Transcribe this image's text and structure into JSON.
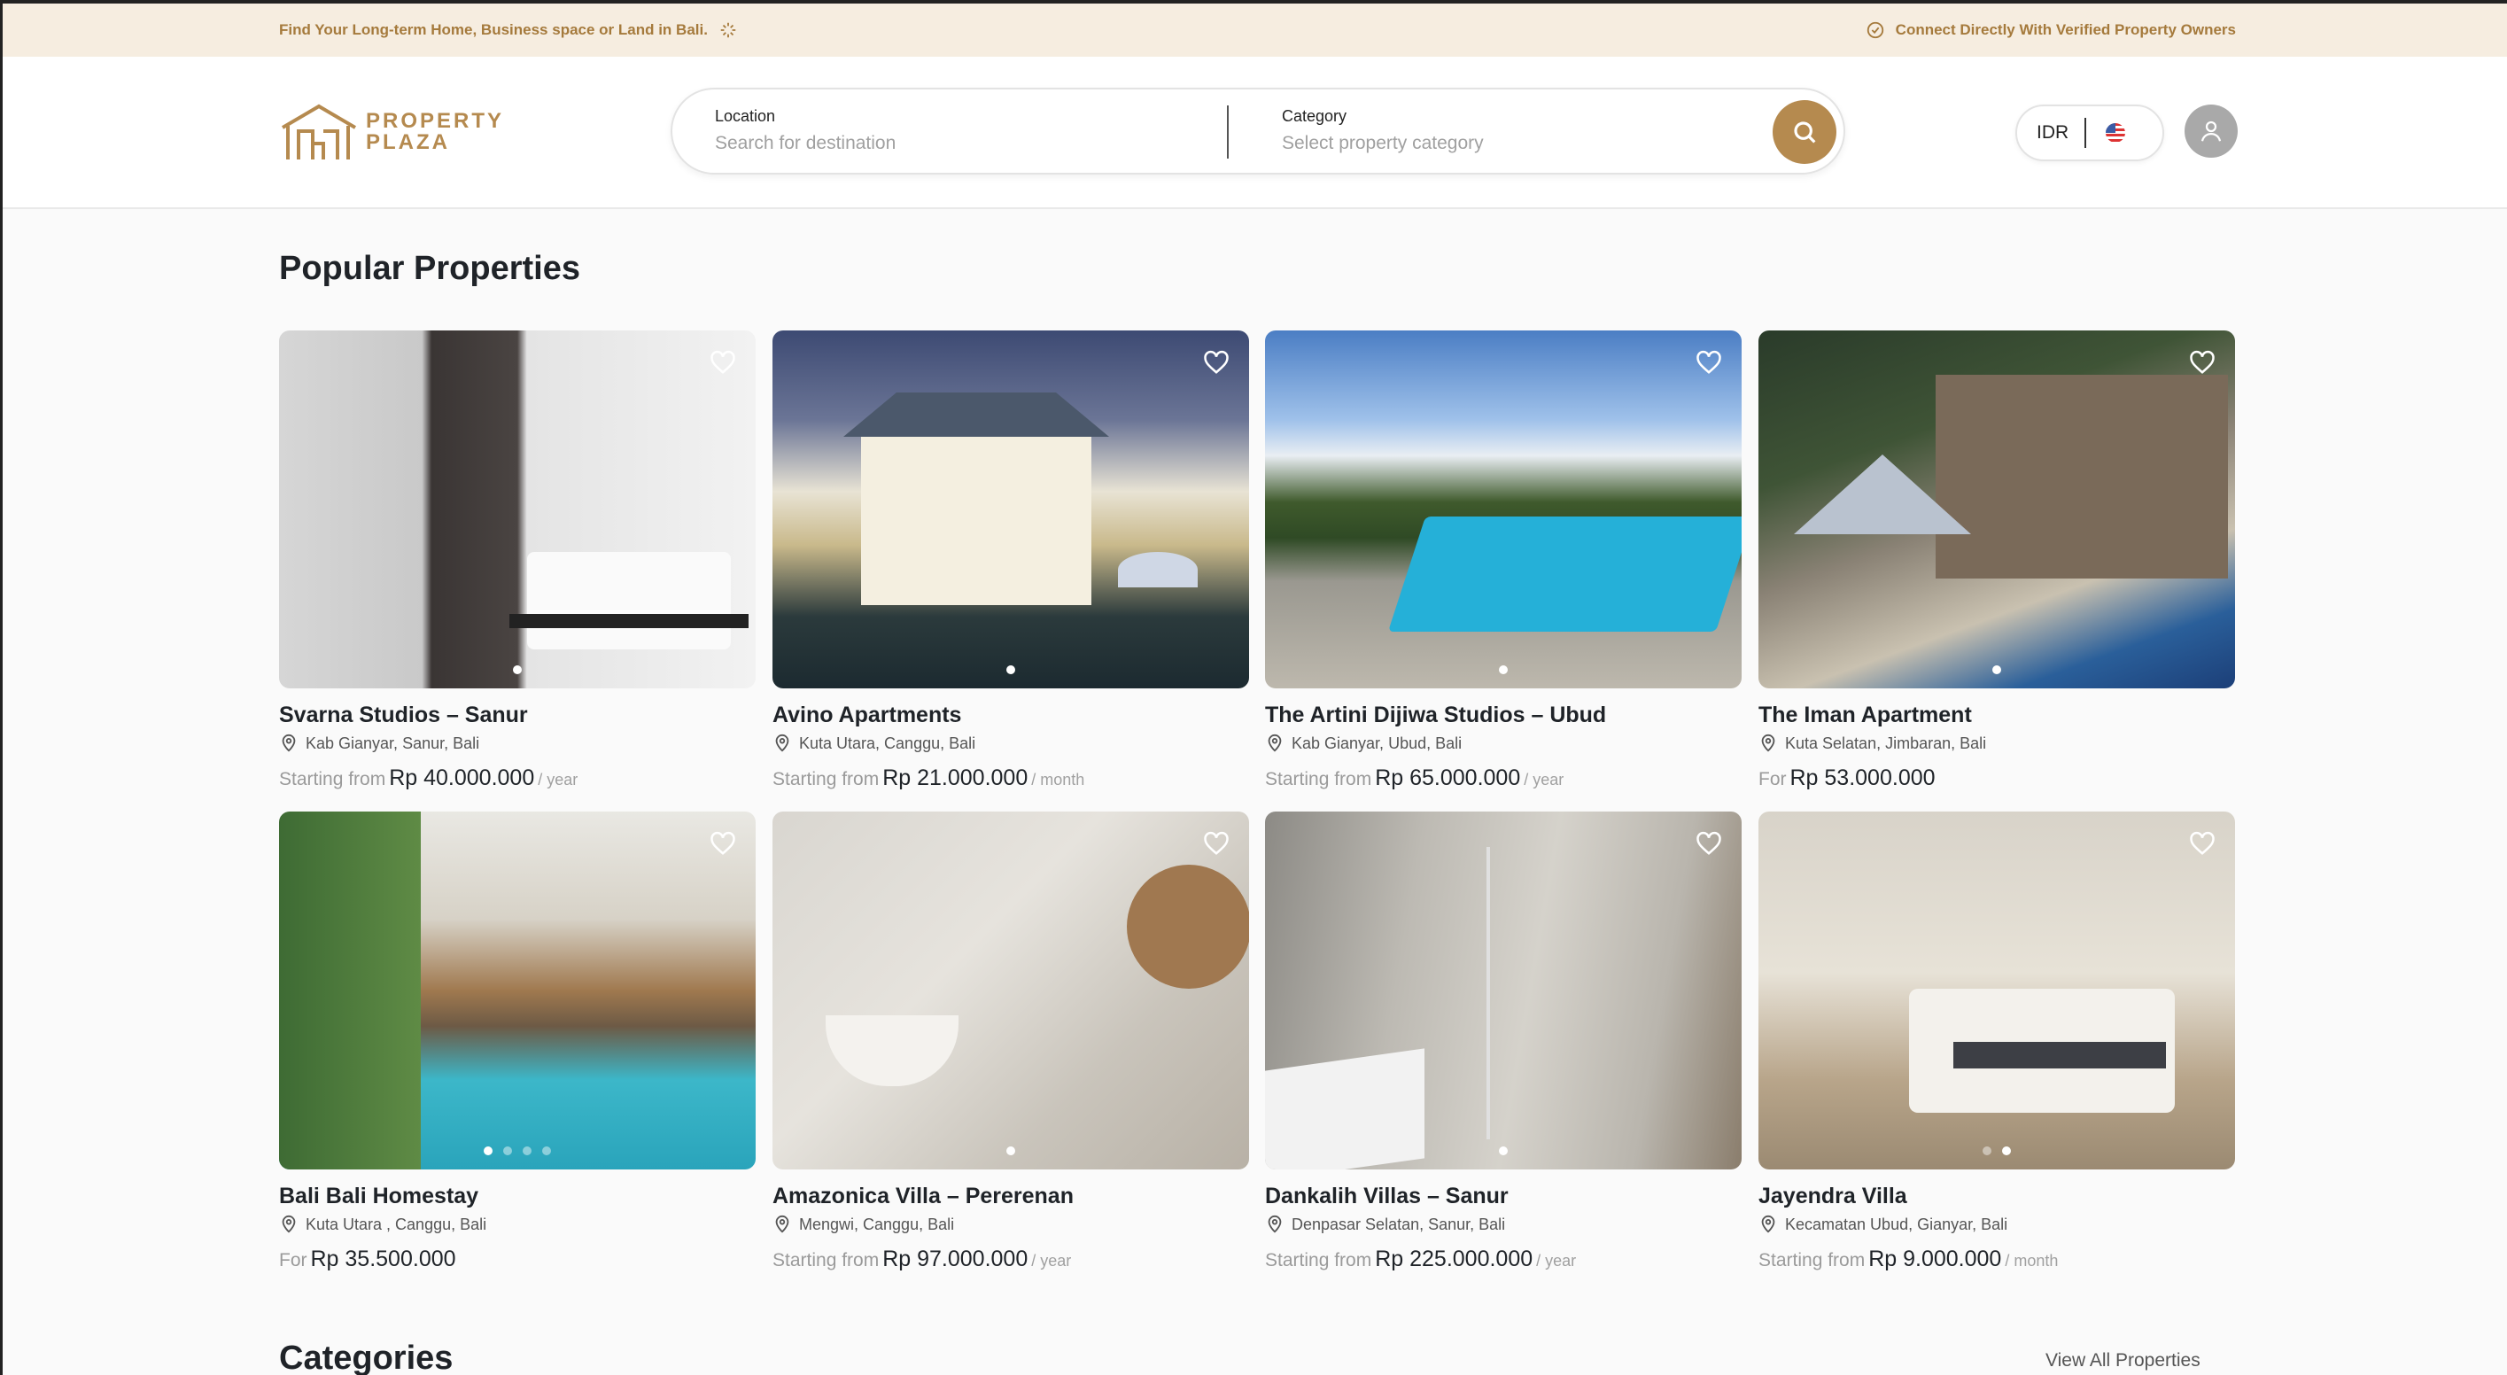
{
  "announcement": {
    "left_text": "Find Your Long-term Home, Business space or Land in Bali.",
    "right_text": "Connect Directly With Verified Property Owners"
  },
  "header": {
    "logo": {
      "line1": "PROPERTY",
      "line2": "PLAZA"
    },
    "search": {
      "location_label": "Location",
      "location_placeholder": "Search for destination",
      "category_label": "Category",
      "category_placeholder": "Select property category"
    },
    "currency": "IDR"
  },
  "colors": {
    "brand": "#b58a4f",
    "announcement_bg": "#f6ede0"
  },
  "popular": {
    "title": "Popular Properties",
    "items": [
      {
        "title": "Svarna Studios – Sanur",
        "location": "Kab Gianyar, Sanur, Bali",
        "prefix": "Starting from",
        "price": "Rp 40.000.000",
        "period": "/ year"
      },
      {
        "title": "Avino Apartments",
        "location": "Kuta Utara, Canggu, Bali",
        "prefix": "Starting from",
        "price": "Rp 21.000.000",
        "period": "/ month"
      },
      {
        "title": "The Artini Dijiwa Studios – Ubud",
        "location": "Kab Gianyar, Ubud, Bali",
        "prefix": "Starting from",
        "price": "Rp 65.000.000",
        "period": "/ year"
      },
      {
        "title": "The Iman Apartment",
        "location": "Kuta Selatan, Jimbaran, Bali",
        "prefix": "For",
        "price": "Rp 53.000.000",
        "period": ""
      },
      {
        "title": "Bali Bali Homestay",
        "location": "Kuta Utara , Canggu, Bali",
        "prefix": "For",
        "price": "Rp 35.500.000",
        "period": ""
      },
      {
        "title": "Amazonica Villa – Pererenan",
        "location": "Mengwi, Canggu, Bali",
        "prefix": "Starting from",
        "price": "Rp 97.000.000",
        "period": "/ year"
      },
      {
        "title": "Dankalih Villas – Sanur",
        "location": "Denpasar Selatan, Sanur, Bali",
        "prefix": "Starting from",
        "price": "Rp 225.000.000",
        "period": "/ year"
      },
      {
        "title": "Jayendra Villa",
        "location": "Kecamatan Ubud, Gianyar, Bali",
        "prefix": "Starting from",
        "price": "Rp 9.000.000",
        "period": "/ month"
      }
    ]
  },
  "categories": {
    "title": "Categories",
    "view_all": "View All Properties"
  }
}
